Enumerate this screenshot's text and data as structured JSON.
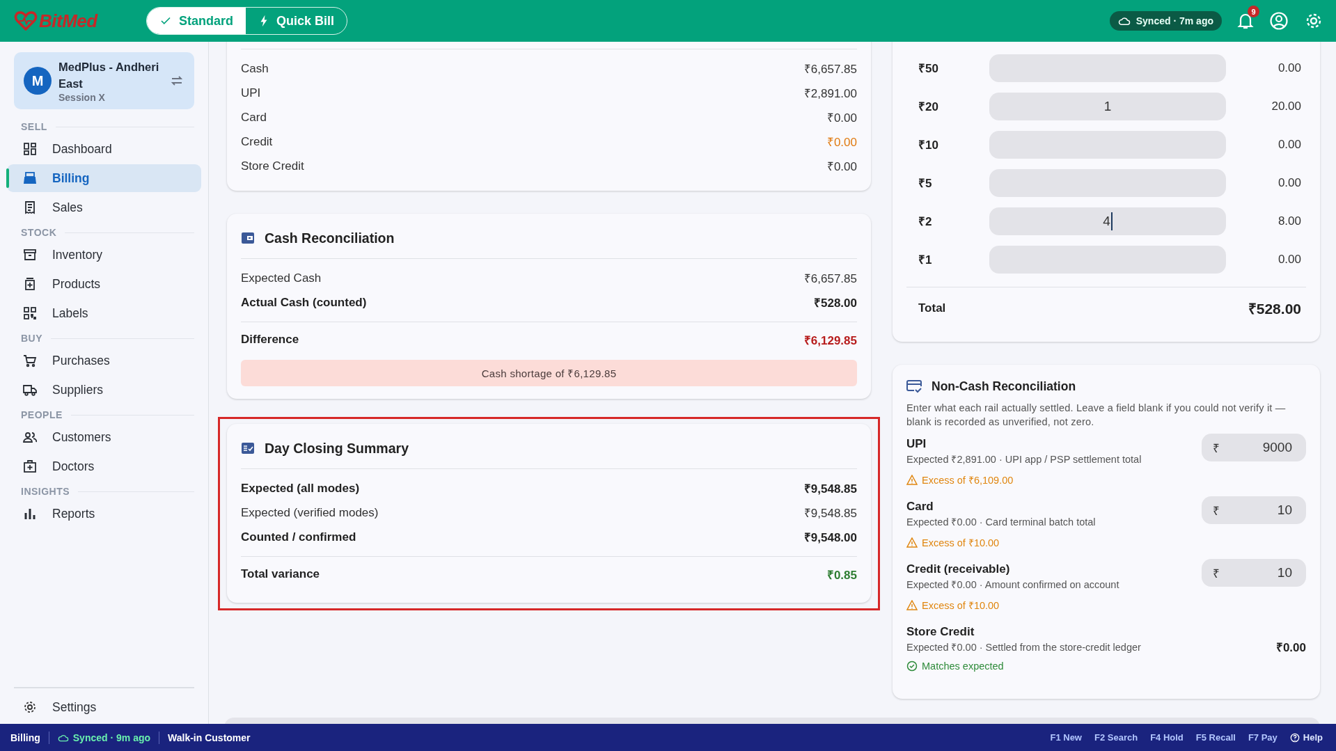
{
  "topbar": {
    "brand": "BitMed",
    "modes": [
      {
        "label": "Standard",
        "selected": true
      },
      {
        "label": "Quick Bill",
        "selected": false
      }
    ],
    "sync": "Synced · 7m ago",
    "notifications": "9"
  },
  "sidebar": {
    "store": {
      "avatar": "M",
      "name": "MedPlus - Andheri East",
      "session": "Session X"
    },
    "sections": [
      {
        "title": "SELL",
        "items": [
          {
            "label": "Dashboard",
            "selected": false
          },
          {
            "label": "Billing",
            "selected": true
          },
          {
            "label": "Sales",
            "selected": false
          }
        ]
      },
      {
        "title": "STOCK",
        "items": [
          {
            "label": "Inventory",
            "selected": false
          },
          {
            "label": "Products",
            "selected": false
          },
          {
            "label": "Labels",
            "selected": false
          }
        ]
      },
      {
        "title": "BUY",
        "items": [
          {
            "label": "Purchases",
            "selected": false
          },
          {
            "label": "Suppliers",
            "selected": false
          }
        ]
      },
      {
        "title": "PEOPLE",
        "items": [
          {
            "label": "Customers",
            "selected": false
          },
          {
            "label": "Doctors",
            "selected": false
          }
        ]
      },
      {
        "title": "INSIGHTS",
        "items": [
          {
            "label": "Reports",
            "selected": false
          }
        ]
      }
    ],
    "footer": {
      "label": "Settings"
    }
  },
  "payment_modes": {
    "rows": [
      {
        "label": "Cash",
        "value": "₹6,657.85"
      },
      {
        "label": "UPI",
        "value": "₹2,891.00"
      },
      {
        "label": "Card",
        "value": "₹0.00"
      },
      {
        "label": "Credit",
        "value": "₹0.00",
        "color": "#e07a10"
      },
      {
        "label": "Store Credit",
        "value": "₹0.00"
      }
    ]
  },
  "cash_reconciliation": {
    "title": "Cash Reconciliation",
    "rows": [
      {
        "label": "Expected Cash",
        "value": "₹6,657.85",
        "bold": false
      },
      {
        "label": "Actual Cash (counted)",
        "value": "₹528.00",
        "bold": true
      }
    ],
    "total": {
      "label": "Difference",
      "value": "₹6,129.85",
      "color": "#b71c1c"
    },
    "alert": "Cash shortage of ₹6,129.85"
  },
  "day_closing_summary": {
    "title": "Day Closing Summary",
    "highlighted": true,
    "rows": [
      {
        "label": "Expected (all modes)",
        "value": "₹9,548.85",
        "bold": true
      },
      {
        "label": "Expected (verified modes)",
        "value": "₹9,548.85",
        "bold": false
      },
      {
        "label": "Counted / confirmed",
        "value": "₹9,548.00",
        "bold": true
      }
    ],
    "total": {
      "label": "Total variance",
      "value": "₹0.85",
      "color": "#2e7d32"
    }
  },
  "denominations": {
    "rows": [
      {
        "label": "₹50",
        "amount": "0.00",
        "focused": false
      },
      {
        "label": "₹20",
        "count": "1",
        "amount": "20.00",
        "focused": false
      },
      {
        "label": "₹10",
        "amount": "0.00",
        "focused": false
      },
      {
        "label": "₹5",
        "amount": "0.00",
        "focused": false
      },
      {
        "label": "₹2",
        "count": "4",
        "amount": "8.00",
        "focused": true
      },
      {
        "label": "₹1",
        "amount": "0.00",
        "focused": false
      }
    ],
    "total": {
      "label": "Total",
      "value": "₹528.00"
    }
  },
  "non_cash_reconciliation": {
    "title": "Non-Cash Reconciliation",
    "description": "Enter what each rail actually settled. Leave a field blank if you could not verify it — blank is recorded as unverified, not zero.",
    "rails": [
      {
        "name": "UPI",
        "expected": "Expected ₹2,891.00 · UPI app / PSP settlement total",
        "kind": "input",
        "currency": "₹",
        "value": "9000",
        "status": {
          "kind": "warning",
          "text": "Excess of ₹6,109.00"
        }
      },
      {
        "name": "Card",
        "expected": "Expected ₹0.00 · Card terminal batch total",
        "kind": "input",
        "currency": "₹",
        "value": "10",
        "status": {
          "kind": "warning",
          "text": "Excess of ₹10.00"
        }
      },
      {
        "name": "Credit (receivable)",
        "expected": "Expected ₹0.00 · Amount confirmed on account",
        "kind": "input",
        "currency": "₹",
        "value": "10",
        "status": {
          "kind": "warning",
          "text": "Excess of ₹10.00"
        }
      },
      {
        "name": "Store Credit",
        "expected": "Expected ₹0.00 · Settled from the store-credit ledger",
        "kind": "fixed",
        "value": "₹0.00",
        "status": {
          "kind": "ok",
          "text": "Matches expected"
        }
      }
    ]
  },
  "status_bar": {
    "page": "Billing",
    "sync": "Synced · 9m ago",
    "customer": "Walk-in Customer",
    "shortcuts": [
      "F1 New",
      "F2 Search",
      "F4 Hold",
      "F5 Recall",
      "F7 Pay"
    ],
    "help": "Help"
  }
}
